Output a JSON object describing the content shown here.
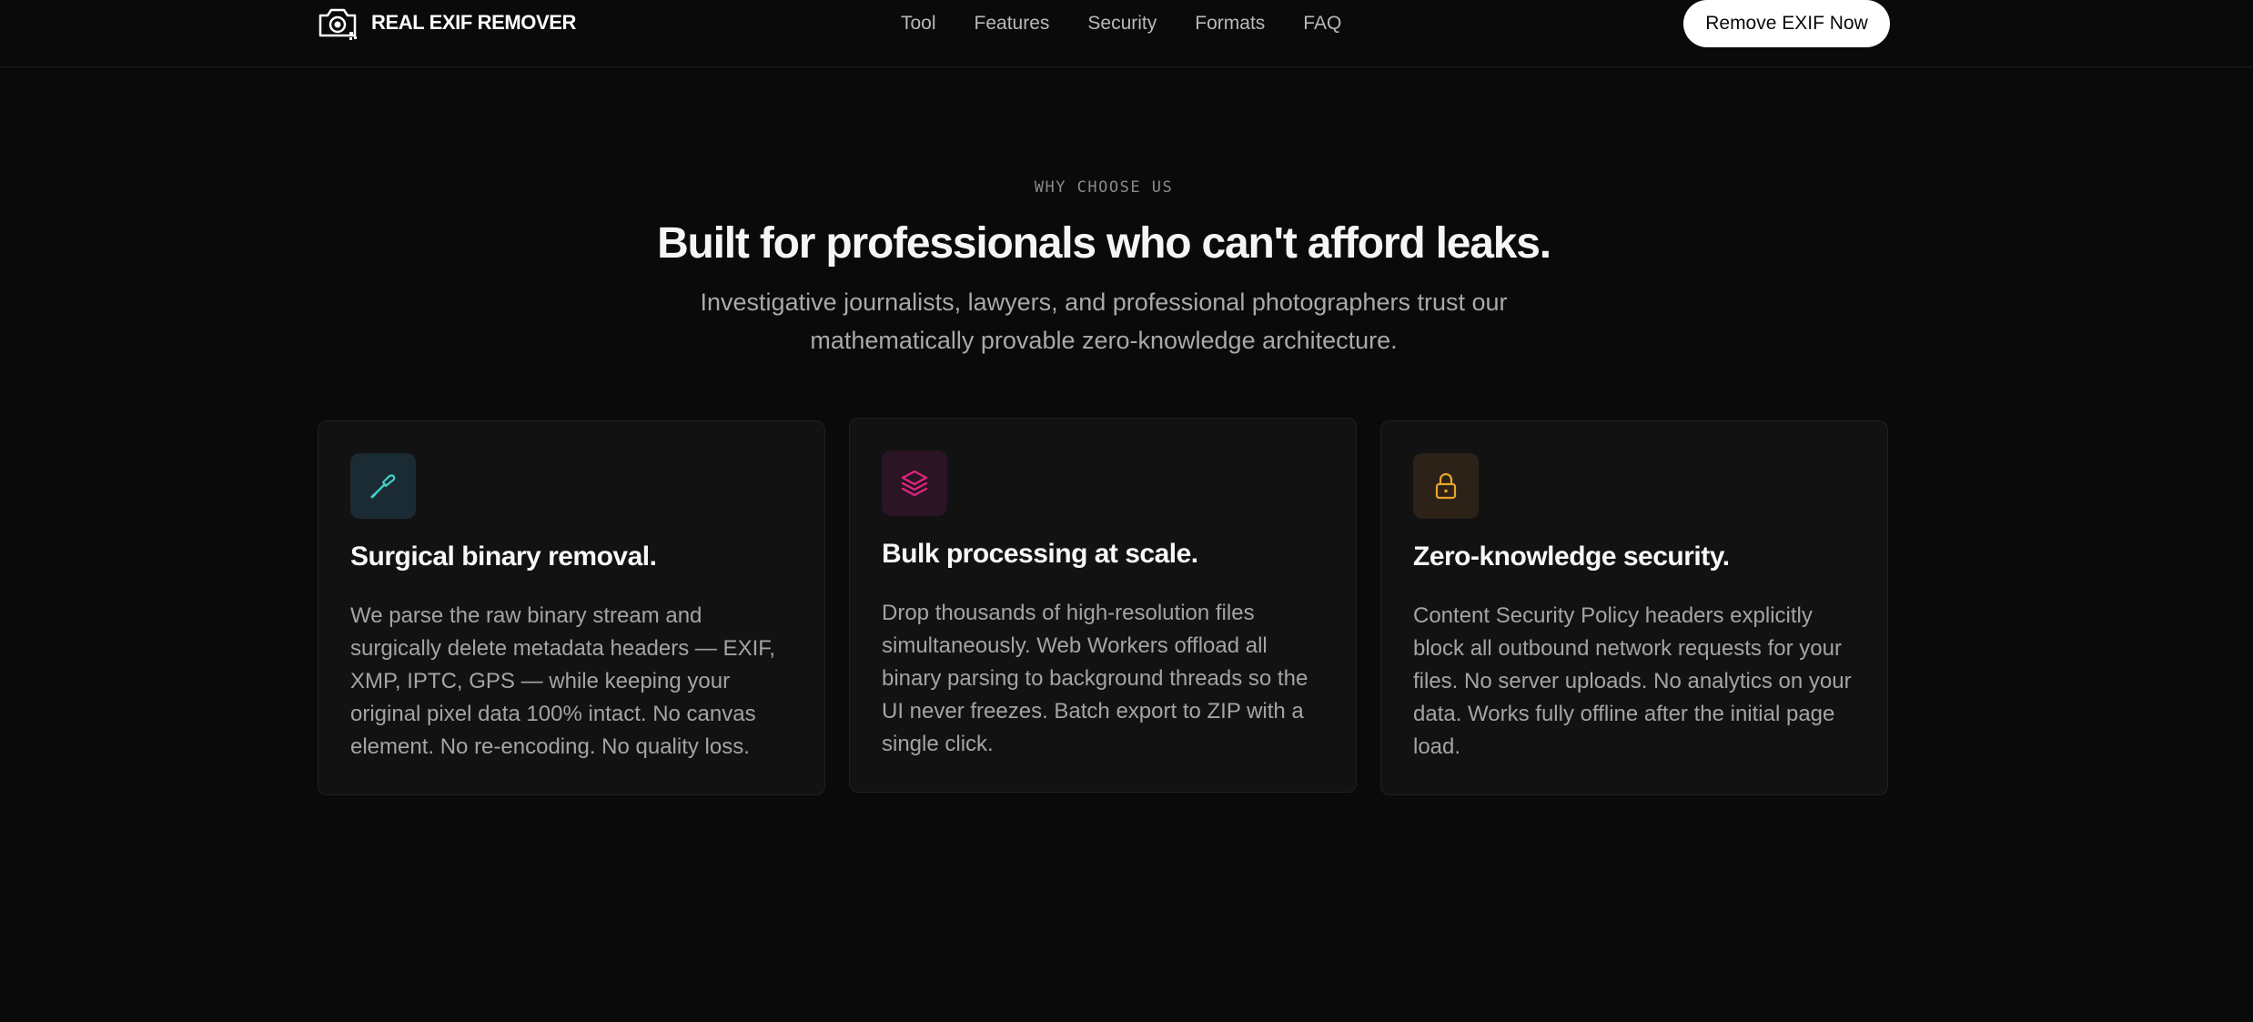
{
  "brand": {
    "name": "REAL EXIF REMOVER",
    "icon": "camera-icon"
  },
  "nav": {
    "items": [
      {
        "label": "Tool"
      },
      {
        "label": "Features"
      },
      {
        "label": "Security"
      },
      {
        "label": "Formats"
      },
      {
        "label": "FAQ"
      }
    ],
    "cta_label": "Remove EXIF Now"
  },
  "section": {
    "eyebrow": "WHY CHOOSE US",
    "title": "Built for professionals who can't afford leaks.",
    "subtitle": "Investigative journalists, lawyers, and professional photographers trust our mathematically provable zero-knowledge architecture."
  },
  "features": [
    {
      "icon": "scalpel-icon",
      "icon_color": "#3fd0c9",
      "title": "Surgical binary removal.",
      "body": "We parse the raw binary stream and surgically delete metadata headers — EXIF, XMP, IPTC, GPS — while keeping your original pixel data 100% intact. No canvas element. No re-encoding. No quality loss."
    },
    {
      "icon": "layers-icon",
      "icon_color": "#e0267f",
      "title": "Bulk processing at scale.",
      "body": "Drop thousands of high-resolution files simultaneously. Web Workers offload all binary parsing to background threads so the UI never freezes. Batch export to ZIP with a single click."
    },
    {
      "icon": "lock-icon",
      "icon_color": "#e8a42a",
      "title": "Zero-knowledge security.",
      "body": "Content Security Policy headers explicitly block all outbound network requests for your files. No server uploads. No analytics on your data. Works fully offline after the initial page load."
    }
  ],
  "colors": {
    "background": "#0a0a0a",
    "card": "#121212",
    "cta_bg": "#ffffff"
  }
}
